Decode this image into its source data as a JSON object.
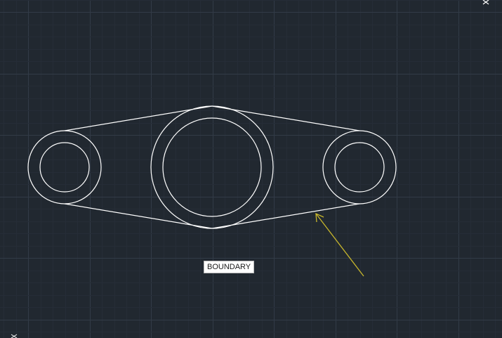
{
  "canvas": {
    "background_color": "#212830",
    "major_grid_color": "#323b47",
    "minor_grid_color": "#262d37",
    "geometry_color": "#ffffff",
    "leader_color": "#c7b62c"
  },
  "drawing": {
    "boundary_label": "BOUNDARY"
  },
  "icons": {
    "cursor": "crosshair-cursor-icon",
    "ucs": "ucs-axis-icon"
  }
}
